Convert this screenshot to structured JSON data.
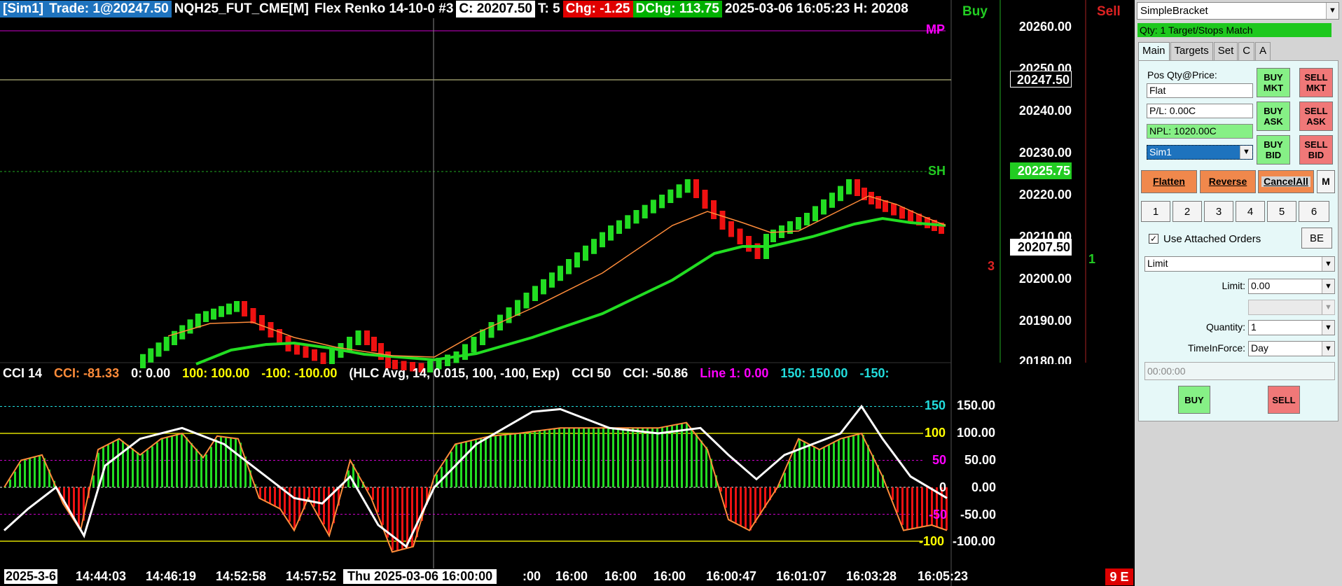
{
  "header": {
    "account": "[Sim1]",
    "trade": "Trade: 1@20247.50",
    "symbol": "NQH25_FUT_CME[M]",
    "bar_type": "Flex Renko 14-10-0 #3",
    "close": "C: 20207.50",
    "ticks": "T: 5",
    "chg": "Chg: -1.25",
    "dchg": "DChg: 113.75",
    "datetime": "2025-03-06  16:05:23  H: 20208"
  },
  "chart_labels": {
    "buy": "Buy",
    "sell": "Sell",
    "mp": "MP",
    "sh": "SH",
    "buy_count": "1",
    "sell_count": "3",
    "corner_badge": "9 E"
  },
  "price_axis": {
    "ticks": [
      "20260.00",
      "20250.00",
      "20240.00",
      "20230.00",
      "20220.00",
      "20210.00",
      "20200.00",
      "20190.00",
      "20180.00"
    ],
    "position_price": "20247.50",
    "sh_price": "20225.75",
    "last_price": "20207.50"
  },
  "cci_legend": {
    "name": "CCI 14",
    "cci": "CCI: -81.33",
    "zero": "0: 0.00",
    "p100": "100: 100.00",
    "m100": "-100: -100.00",
    "params": "(HLC Avg, 14, 0.015, 100, -100, Exp)",
    "name2": "CCI 50",
    "cci2": "CCI: -50.86",
    "line1": "Line 1: 0.00",
    "p150": "150: 150.00",
    "m150": "-150:"
  },
  "cci_axis": {
    "ticks": [
      "150.00",
      "100.00",
      "50.00",
      "0.00",
      "-50.00",
      "-100.00"
    ],
    "inner": [
      "150",
      "100",
      "50",
      "0",
      "-50",
      "-100"
    ]
  },
  "time_axis": {
    "labels": [
      "2025-3-6",
      "14:44:03",
      "14:46:19",
      "14:52:58",
      "14:57:52",
      "Thu 2025-03-06  16:00:00",
      ":00",
      "16:00",
      "16:00",
      "16:00",
      "16:00:47",
      "16:01:07",
      "16:03:28",
      "16:05:23"
    ]
  },
  "panel": {
    "strategy": "SimpleBracket",
    "status": "Qty: 1 Target/Stops Match",
    "tabs": [
      "Main",
      "Targets",
      "Set",
      "C",
      "A"
    ],
    "pos_label": "Pos Qty@Price:",
    "pos_value": "Flat",
    "pl": "P/L: 0.00C",
    "npl": "NPL: 1020.00C",
    "account": "Sim1",
    "buy_mkt": "BUY MKT",
    "sell_mkt": "SELL MKT",
    "buy_ask": "BUY ASK",
    "sell_ask": "SELL ASK",
    "buy_bid": "BUY BID",
    "sell_bid": "SELL BID",
    "flatten": "Flatten",
    "reverse": "Reverse",
    "cancel_all": "CancelAll",
    "m": "M",
    "qty_buttons": [
      "1",
      "2",
      "3",
      "4",
      "5",
      "6"
    ],
    "use_attached": "Use Attached Orders",
    "be": "BE",
    "order_type": "Limit",
    "limit_label": "Limit:",
    "limit_value": "0.00",
    "quantity_label": "Quantity:",
    "quantity_value": "1",
    "tif_label": "TimeInForce:",
    "tif_value": "Day",
    "time_value": "00:00:00",
    "buy": "BUY",
    "sell": "SELL"
  },
  "colors": {
    "up_bar": "#22dd22",
    "down_bar": "#ee1111",
    "ma_fast": "#ff8c3a",
    "ma_slow": "#22dd22",
    "cci_line": "#ffffff"
  }
}
